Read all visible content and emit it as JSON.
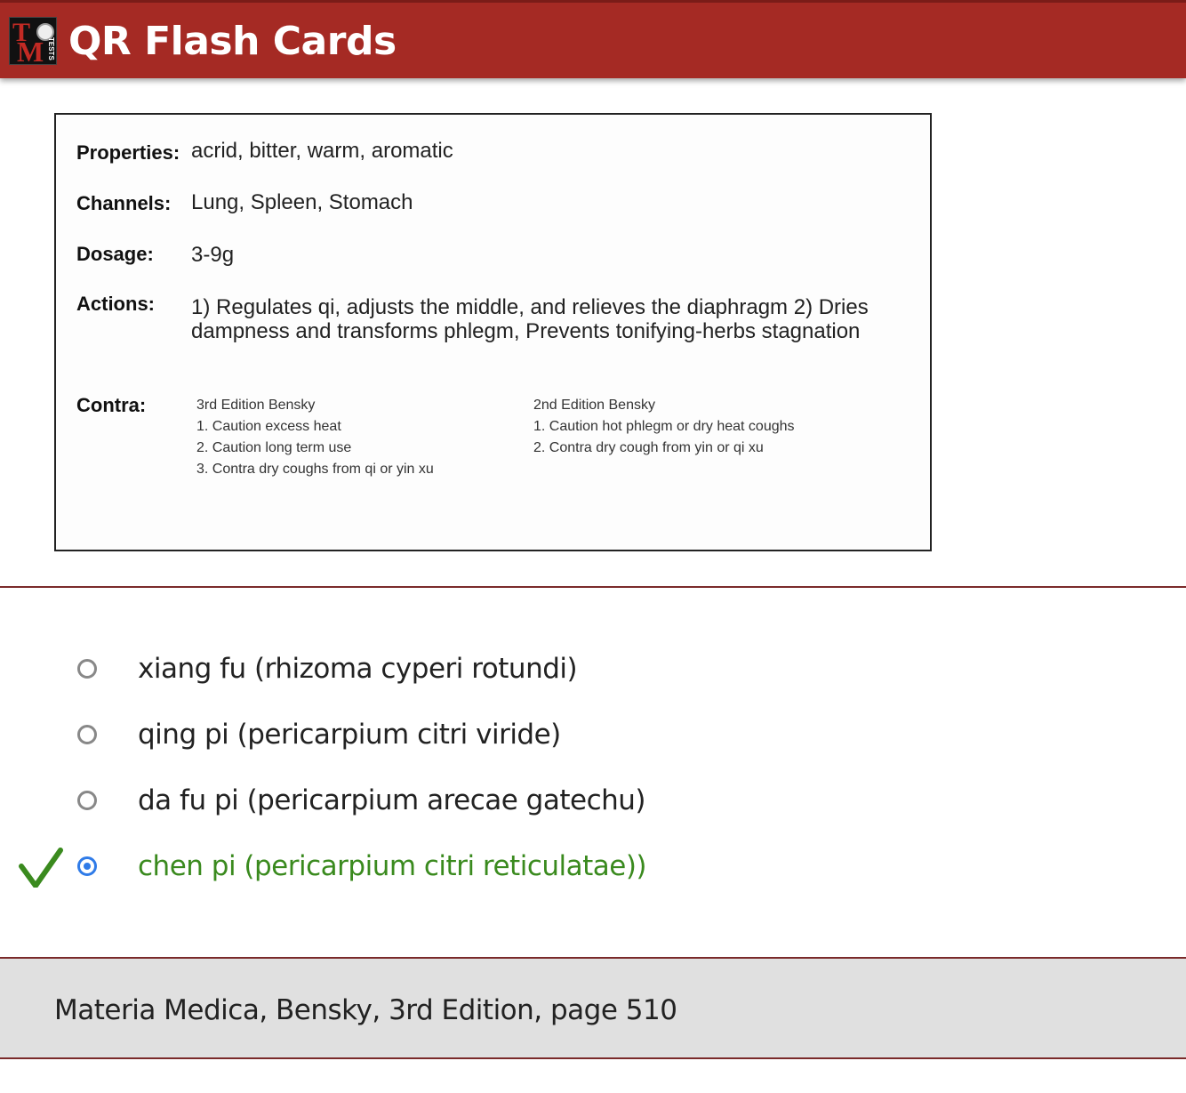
{
  "header": {
    "title": "QR Flash Cards"
  },
  "card": {
    "properties_label": "Properties:",
    "properties_value": "acrid, bitter, warm, aromatic",
    "channels_label": "Channels:",
    "channels_value": "Lung, Spleen, Stomach",
    "dosage_label": "Dosage:",
    "dosage_value": "3-9g",
    "actions_label": "Actions:",
    "actions_value": "1) Regulates qi, adjusts the middle, and relieves the diaphragm 2) Dries dampness and transforms phlegm, Prevents tonifying-herbs stagnation",
    "contra_label": "Contra:",
    "contra_3rd": {
      "heading": "3rd Edition Bensky",
      "items": [
        "1. Caution excess heat",
        "2. Caution long term use",
        "3. Contra dry coughs from qi or yin xu"
      ]
    },
    "contra_2nd": {
      "heading": "2nd Edition Bensky",
      "items": [
        "1. Caution hot phlegm or dry heat coughs",
        "2. Contra dry cough from  yin or qi xu"
      ]
    }
  },
  "options": [
    {
      "label": "xiang fu (rhizoma cyperi rotundi)",
      "selected": false,
      "correct": false
    },
    {
      "label": "qing pi (pericarpium citri viride)",
      "selected": false,
      "correct": false
    },
    {
      "label": "da fu pi (pericarpium arecae gatechu)",
      "selected": false,
      "correct": false
    },
    {
      "label": "chen pi (pericarpium citri reticulatae))",
      "selected": true,
      "correct": true
    }
  ],
  "footer": {
    "source": "Materia Medica, Bensky, 3rd Edition, page 510"
  },
  "colors": {
    "header_bg": "#a52a24",
    "correct_green": "#3a8a1e",
    "radio_selected": "#2f7be8",
    "divider": "#7a2a2a"
  }
}
